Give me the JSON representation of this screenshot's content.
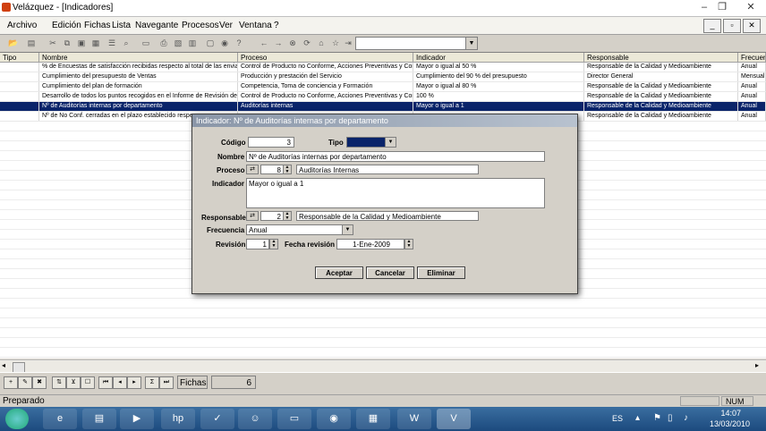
{
  "window": {
    "title": "Velázquez - [Indicadores]"
  },
  "menu": [
    "Archivo",
    "Edición",
    "Fichas",
    "Lista",
    "Navegante",
    "Procesos",
    "Ver",
    "Ventana",
    "?"
  ],
  "grid": {
    "columns": [
      "Tipo",
      "Nombre",
      "Proceso",
      "Indicador",
      "Responsable",
      "Frecuen"
    ],
    "rows": [
      [
        "",
        "% de Encuestas de satisfacción recibidas respecto al total de las envia",
        "Control de Producto no Conforme, Acciones Preventivas y Corr",
        "Mayor o igual al 50 %",
        "Responsable de la Calidad y Medioambiente",
        "Anual"
      ],
      [
        "",
        "Cumplimiento del presupuesto de Ventas",
        "Producción y prestación del Servicio",
        "Cumplimiento del 90 % del presupuesto",
        "Director General",
        "Mensual"
      ],
      [
        "",
        "Cumplimiento del plan de formación",
        "Competencia, Toma de conciencia y Formación",
        "Mayor o igual al 80 %",
        "Responsable de la Calidad y Medioambiente",
        "Anual"
      ],
      [
        "",
        "Desarrollo de todos los puntos recogidos en el Informe de Revisión del",
        "Control de Producto no Conforme, Acciones Preventivas y Corr",
        "100 %",
        "Responsable de la Calidad y Medioambiente",
        "Anual"
      ],
      [
        "",
        "Nº de Auditorías internas por departamento",
        "Auditorías internas",
        "Mayor o igual a 1",
        "Responsable de la Calidad y Medioambiente",
        "Anual"
      ],
      [
        "",
        "Nº de No Conf. cerradas en el plazo establecido respe",
        "",
        "",
        "Responsable de la Calidad y Medioambiente",
        "Anual"
      ]
    ],
    "selected_row": 4
  },
  "nav": {
    "fichas_label": "Fichas",
    "fichas_count": "6"
  },
  "status": {
    "text": "Preparado",
    "num": "NUM"
  },
  "dialog": {
    "title": "Indicador: Nº de Auditorías internas por departamento",
    "codigo_label": "Código",
    "codigo": "3",
    "tipo_label": "Tipo",
    "tipo": "",
    "nombre_label": "Nombre",
    "nombre": "Nº de Auditorías internas por departamento",
    "proceso_label": "Proceso",
    "proceso_id": "8",
    "proceso": "Auditorías Internas",
    "indicador_label": "Indicador",
    "indicador": "Mayor o igual a 1",
    "responsable_label": "Responsable",
    "responsable_id": "2",
    "responsable": "Responsable de la Calidad y Medioambiente",
    "frecuencia_label": "Frecuencia",
    "frecuencia": "Anual",
    "revision_label": "Revisión",
    "revision": "1",
    "fecha_label": "Fecha revisión",
    "fecha": "1-Ene-2009",
    "buttons": {
      "aceptar": "Aceptar",
      "cancelar": "Cancelar",
      "eliminar": "Eliminar"
    }
  },
  "taskbar": {
    "lang": "ES",
    "time": "14:07",
    "date": "13/03/2010"
  },
  "colors": {
    "selection": "#0a246a",
    "dialog_title": "#8a96a8",
    "taskbar": "#1c4a7e"
  }
}
